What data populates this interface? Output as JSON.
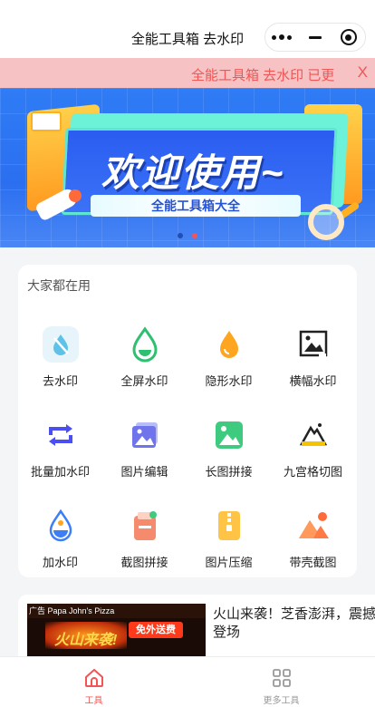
{
  "nav": {
    "title": "全能工具箱 去水印"
  },
  "notice": {
    "text": "全能工具箱 去水印 已更",
    "close": "X"
  },
  "banner": {
    "title": "欢迎使用~",
    "subtitle": "全能工具箱大全"
  },
  "tools": {
    "section_title": "大家都在用",
    "items": [
      {
        "label": "去水印",
        "icon": "droplet-slash-icon"
      },
      {
        "label": "全屏水印",
        "icon": "water-drop-icon"
      },
      {
        "label": "隐形水印",
        "icon": "orange-drop-icon"
      },
      {
        "label": "横幅水印",
        "icon": "image-frame-icon"
      },
      {
        "label": "批量加水印",
        "icon": "repeat-icon"
      },
      {
        "label": "图片编辑",
        "icon": "photo-stack-icon"
      },
      {
        "label": "长图拼接",
        "icon": "green-image-icon"
      },
      {
        "label": "九宫格切图",
        "icon": "mountain-frame-icon"
      },
      {
        "label": "加水印",
        "icon": "add-drop-icon"
      },
      {
        "label": "截图拼接",
        "icon": "screenshot-icon"
      },
      {
        "label": "图片压缩",
        "icon": "zip-file-icon"
      },
      {
        "label": "带壳截图",
        "icon": "mountain-sun-icon"
      }
    ]
  },
  "news": {
    "title": "火山来袭！芝香澎湃，震撼登场",
    "thumb": {
      "badge": "免外送费",
      "headline": "火山来袭!",
      "brand": "广告 Papa John's Pizza"
    }
  },
  "tabbar": {
    "tabs": [
      {
        "label": "工具",
        "icon": "home-icon",
        "active": true
      },
      {
        "label": "更多工具",
        "icon": "grid-icon",
        "active": false
      }
    ]
  },
  "colors": {
    "accent": "#f15555",
    "notice_bg": "#f6c2c3",
    "banner_blue": "#2f7cf6"
  }
}
